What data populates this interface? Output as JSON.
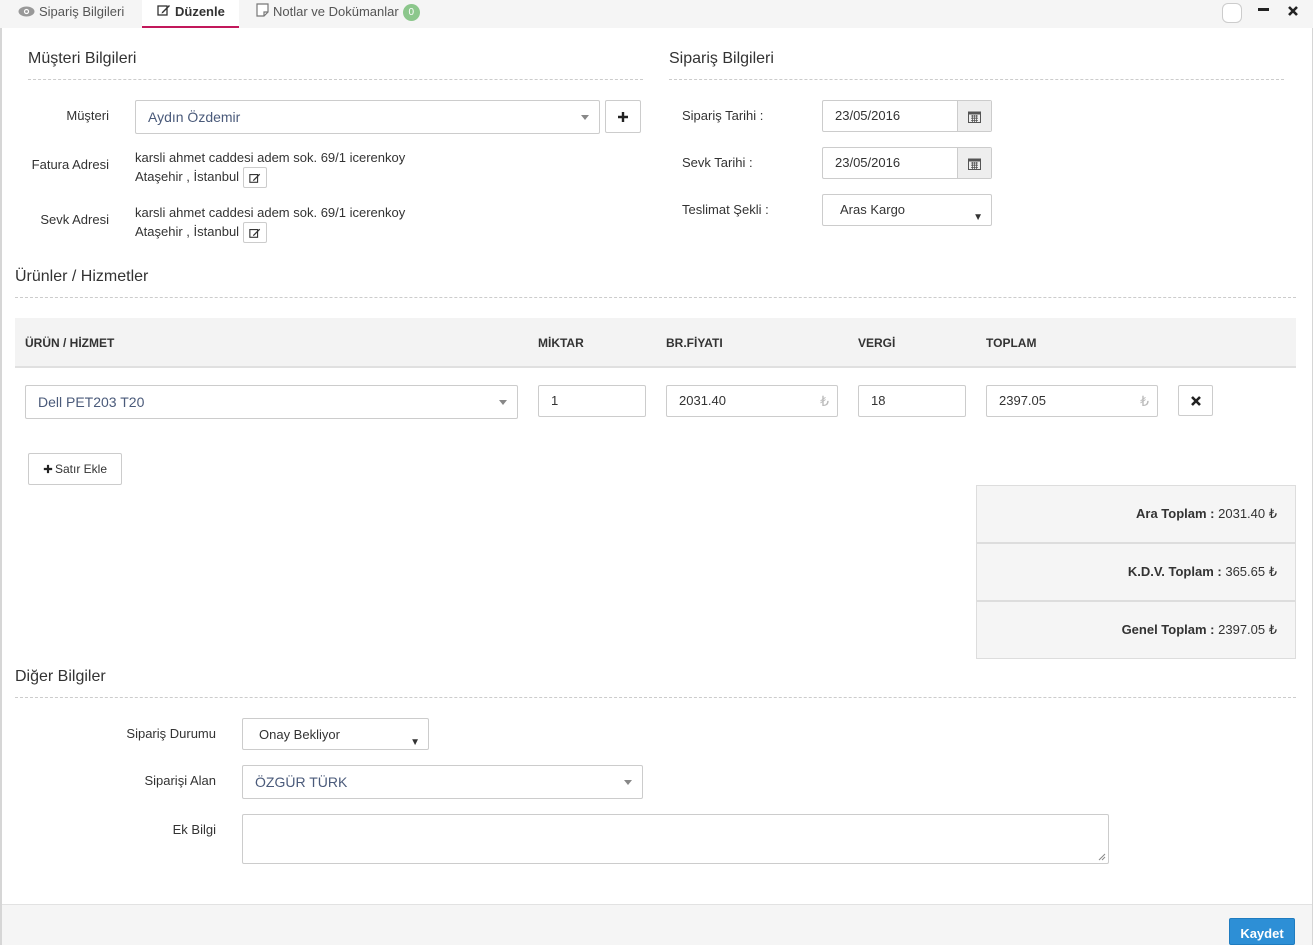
{
  "tabs": [
    {
      "label": "Sipariş Bilgileri",
      "icon": "eye-icon"
    },
    {
      "label": "Düzenle",
      "icon": "edit-icon"
    },
    {
      "label": "Notlar ve Dokümanlar",
      "icon": "note-icon",
      "badge": "0"
    }
  ],
  "customer_section": {
    "title": "Müşteri Bilgileri",
    "customer_label": "Müşteri",
    "customer_value": "Aydın Özdemir",
    "add_icon": "plus-icon",
    "invoice_label": "Fatura Adresi",
    "invoice_line1": "karsli ahmet caddesi adem sok. 69/1 icerenkoy",
    "invoice_line2": "Ataşehir , İstanbul",
    "ship_label": "Sevk Adresi",
    "ship_line1": "karsli ahmet caddesi adem sok. 69/1 icerenkoy",
    "ship_line2": "Ataşehir , İstanbul"
  },
  "order_section": {
    "title": "Sipariş Bilgileri",
    "order_date_label": "Sipariş Tarihi :",
    "order_date": "23/05/2016",
    "ship_date_label": "Sevk Tarihi :",
    "ship_date": "23/05/2016",
    "delivery_label": "Teslimat Şekli :",
    "delivery_value": "Aras Kargo"
  },
  "products": {
    "title": "Ürünler / Hizmetler",
    "headers": {
      "product": "ÜRÜN / HİZMET",
      "qty": "MİKTAR",
      "price": "BR.FİYATI",
      "tax": "VERGİ",
      "total": "TOPLAM"
    },
    "rows": [
      {
        "product": "Dell PET203 T20",
        "qty": "1",
        "price": "2031.40",
        "tax": "18",
        "total": "2397.05"
      }
    ],
    "currency_symbol": "₺",
    "add_row_label": "Satır Ekle"
  },
  "totals": {
    "subtotal_label": "Ara Toplam :",
    "subtotal": "2031.40 ₺",
    "vat_label": "K.D.V. Toplam :",
    "vat": "365.65 ₺",
    "grand_label": "Genel Toplam :",
    "grand": "2397.05 ₺"
  },
  "other": {
    "title": "Diğer Bilgiler",
    "status_label": "Sipariş Durumu",
    "status_value": "Onay Bekliyor",
    "taker_label": "Siparişi Alan",
    "taker_value": "ÖZGÜR TÜRK",
    "extra_label": "Ek Bilgi",
    "extra_value": ""
  },
  "footer": {
    "save_label": "Kaydet"
  }
}
